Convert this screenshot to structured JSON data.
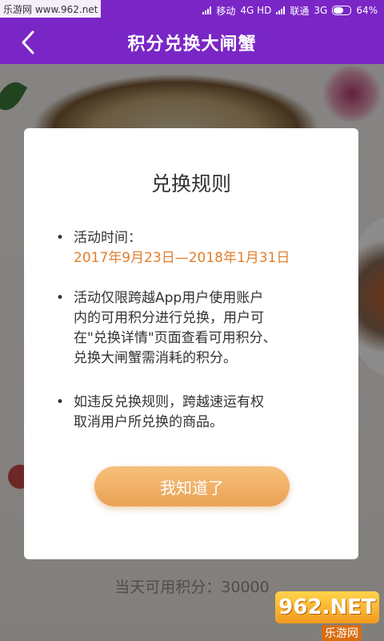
{
  "watermark": {
    "site": "乐游网 www.962.net",
    "logo": "962.NET",
    "logo_sub": "乐游网"
  },
  "statusbar": {
    "carrier1": "移动",
    "network1": "4G HD",
    "carrier2": "联通",
    "network2": "3G",
    "battery": "64%",
    "battery_level": 0.64
  },
  "navbar": {
    "title": "积分兑换大闸蟹",
    "back_icon": "chevron-left-icon"
  },
  "page": {
    "points_label": "当天可用积分：30000"
  },
  "modal": {
    "title": "兑换规则",
    "rules": [
      {
        "line1": "活动时间：",
        "line2": "2017年9月23日—2018年1月31日"
      },
      {
        "lines": [
          "活动仅限跨越App用户使用账户",
          "内的可用积分进行兑换，用户可",
          "在\"兑换详情\"页面查看可用积分、",
          "兑换大闸蟹需消耗的积分。"
        ]
      },
      {
        "lines": [
          "如违反兑换规则，跨越速运有权",
          "取消用户所兑换的商品。"
        ]
      }
    ],
    "button": "我知道了"
  },
  "colors": {
    "brand": "#7a26c6",
    "accent": "#e07f2c",
    "button": "#eea858"
  }
}
